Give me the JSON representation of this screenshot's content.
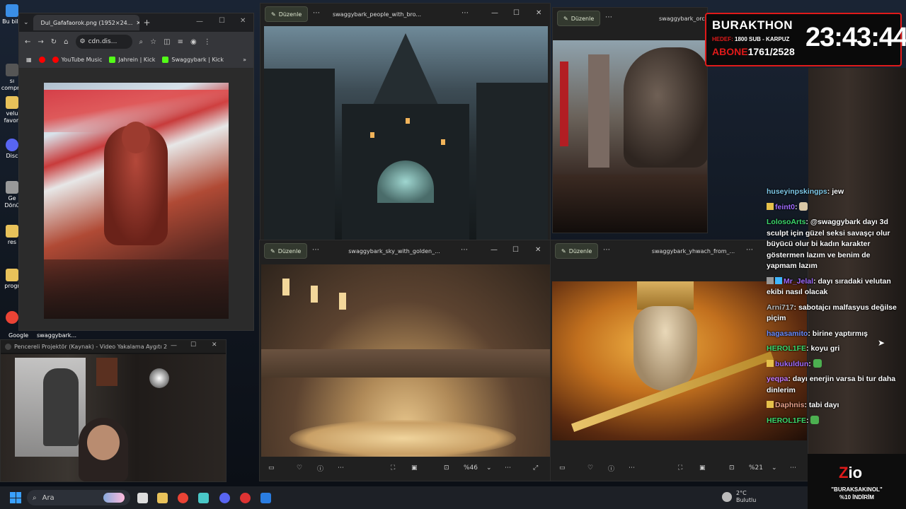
{
  "desktop": {
    "icons": [
      {
        "label": "Bu bilg",
        "color": "#3a8ee6"
      },
      {
        "label": "sı compre",
        "color": "#555"
      },
      {
        "label": "velu favori",
        "color": "#e8c25a"
      },
      {
        "label": "Disc",
        "color": "#5865f2"
      },
      {
        "label": "Ge Dönü",
        "color": "#999"
      },
      {
        "label": "res",
        "color": "#e8c25a"
      },
      {
        "label": "progr",
        "color": "#e8c25a"
      },
      {
        "label": "Google",
        "color": "#ea4335"
      }
    ],
    "bottom_labels": [
      "Google",
      "swaggybark..."
    ]
  },
  "browser": {
    "tab_title": "Dul_Gafafaorok.png (1952×24...",
    "url": "cdn.dis...",
    "bookmarks": [
      {
        "label": "YouTube Music",
        "color": "#ff0000"
      },
      {
        "label": "Jahrein | Kick",
        "color": "#53fc18"
      },
      {
        "label": "Swaggybark | Kick",
        "color": "#53fc18"
      }
    ]
  },
  "camera": {
    "title": "Pencereli Projektör (Kaynak) - Video Yakalama Aygıtı 2"
  },
  "photos": {
    "edit_label": "Düzenle",
    "w1_title": "swaggybark_people_with_bro...",
    "w2_title": "swaggybark_orcs_",
    "w3_title": "swaggybark_sky_with_golden_...",
    "w4_title": "swaggybark_yhwach_from_...",
    "w3_zoom": "%46",
    "w4_zoom": "%21"
  },
  "overlay": {
    "name": "BURAKTHON",
    "goal_label": "HEDEF:",
    "goal_text": "1800 SUB - KARPUZ",
    "sub_label": "ABONE",
    "sub_count": "1761/2528",
    "timer": "23:43:44"
  },
  "chat": [
    {
      "user": "huseyinpskingps",
      "color": "u-cyan",
      "text": "jew"
    },
    {
      "user": "feint0",
      "color": "u-purple",
      "text": "",
      "badge": true
    },
    {
      "user": "LolosoArts",
      "color": "u-green",
      "text": "@swaggybark dayı 3d sculpt için güzel seksi savaşçı olur büyücü olur bi kadın karakter göstermen lazım ve benim de yapmam lazım"
    },
    {
      "user": "Mr_Jelal",
      "color": "u-purple",
      "text": "dayı sıradaki velutan ekibi nasıl olacak",
      "badge": true
    },
    {
      "user": "Arni717",
      "color": "u-gray",
      "text": "sabotajcı malfasyus değilse piçim"
    },
    {
      "user": "hagasamito",
      "color": "u-blue",
      "text": "birine yaptırmış"
    },
    {
      "user": "HEROL1FE",
      "color": "u-green",
      "text": "koyu gri"
    },
    {
      "user": "bukuldun",
      "color": "u-purple",
      "text": "",
      "badge": true
    },
    {
      "user": "yeqpa",
      "color": "u-pink",
      "text": "dayı enerjin varsa bi tur daha dinlerim"
    },
    {
      "user": "Daphnis",
      "color": "u-peach",
      "text": "tabi dayı",
      "badge": true
    },
    {
      "user": "HEROL1FE",
      "color": "u-green",
      "text": ""
    }
  ],
  "taskbar": {
    "search": "Ara",
    "weather_temp": "2°C",
    "weather_desc": "Bulutlu"
  },
  "promo": {
    "line1": "\"BURAKSAKINOL\"",
    "line2": "%10 İNDİRİM"
  }
}
